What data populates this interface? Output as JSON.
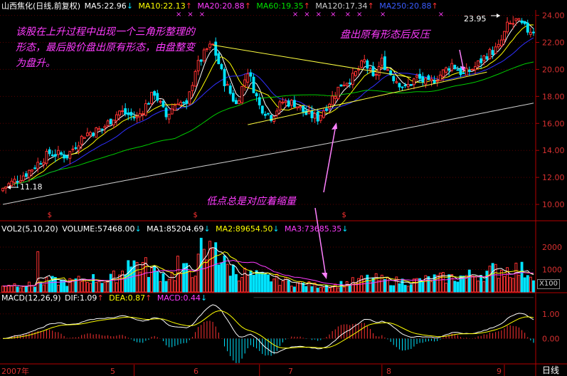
{
  "header": {
    "stock": "山西焦化(日线,前复权)",
    "ma5": "MA5:22.96",
    "ma10": "MA10:22.13",
    "ma20": "MA20:20.88",
    "ma60": "MA60:19.35",
    "ma120": "MA120:17.34",
    "ma250": "MA250:20.88"
  },
  "vol_header": {
    "label": "VOL2(5,10,20)",
    "volume": "VOLUME:57468.00",
    "ma1": "MA1:85204.69",
    "ma2": "MA2:89654.50",
    "ma3": "MA3:73685.35"
  },
  "macd_header": {
    "label": "MACD(12,26,9)",
    "dif": "DIF:1.09",
    "dea": "DEA:0.87",
    "macd": "MACD:0.44"
  },
  "annotations": {
    "triangle_note": "该股在上升过程中出现一个三角形整理的形态，最后股价盘出原有形态，由盘整变为盘升。",
    "breakout_note": "盘出原有形态后反压",
    "volume_note": "低点总是对应着缩量",
    "high_label": "23.95",
    "low_label": "11.18",
    "period_label": "日线",
    "vol_unit": "X100"
  },
  "colors": {
    "up": "#ff3232",
    "down": "#00e4ff",
    "ma5": "#ffffff",
    "ma10": "#ffff00",
    "ma20": "#3030ff",
    "ma60": "#00cc00",
    "ma120": "#cfcfcf",
    "annotation": "#ff3cff",
    "axis": "#b40000"
  },
  "chart_data": {
    "type": "candlestick",
    "x_ticks": [
      "2007年",
      "5",
      "6",
      "7",
      "8",
      "9"
    ],
    "price_axis": {
      "ticks": [
        "24.00",
        "22.00",
        "20.00",
        "18.00",
        "16.00",
        "14.00",
        "12.00",
        "10.00"
      ],
      "ylim": [
        9.0,
        24.4
      ]
    },
    "volume_axis": {
      "ticks": [
        "2000",
        "1000"
      ],
      "ylim": [
        0,
        2700
      ]
    },
    "macd_axis": {
      "ticks": [
        "1.00",
        "0.00"
      ],
      "ylim": [
        -1.0,
        1.6
      ]
    },
    "anchors": [
      [
        0,
        11.2
      ],
      [
        8,
        12.3
      ],
      [
        16,
        13.8
      ],
      [
        22,
        13.6
      ],
      [
        28,
        15.2
      ],
      [
        34,
        15.6
      ],
      [
        40,
        16.9
      ],
      [
        46,
        16.4
      ],
      [
        52,
        18.3
      ],
      [
        56,
        16.5
      ],
      [
        60,
        17.7
      ],
      [
        63,
        17.2
      ],
      [
        66,
        20.0
      ],
      [
        70,
        21.5
      ],
      [
        72,
        21.8
      ],
      [
        76,
        19.1
      ],
      [
        80,
        17.4
      ],
      [
        84,
        19.9
      ],
      [
        88,
        17.3
      ],
      [
        92,
        16.5
      ],
      [
        96,
        17.6
      ],
      [
        100,
        17.5
      ],
      [
        104,
        16.7
      ],
      [
        108,
        16.4
      ],
      [
        112,
        17.6
      ],
      [
        116,
        18.9
      ],
      [
        120,
        19.4
      ],
      [
        124,
        20.6
      ],
      [
        127,
        19.3
      ],
      [
        130,
        20.6
      ],
      [
        134,
        19.4
      ],
      [
        138,
        18.6
      ],
      [
        142,
        19.4
      ],
      [
        146,
        18.9
      ],
      [
        150,
        19.6
      ],
      [
        154,
        20.4
      ],
      [
        158,
        19.6
      ],
      [
        162,
        20.2
      ],
      [
        166,
        21.1
      ],
      [
        170,
        21.6
      ],
      [
        173,
        23.2
      ],
      [
        176,
        23.6
      ],
      [
        180,
        22.9
      ]
    ],
    "volume_anchors": [
      [
        0,
        350
      ],
      [
        12,
        300
      ],
      [
        16,
        500
      ],
      [
        22,
        420
      ],
      [
        30,
        600
      ],
      [
        36,
        500
      ],
      [
        46,
        1300
      ],
      [
        52,
        900
      ],
      [
        56,
        700
      ],
      [
        60,
        800
      ],
      [
        66,
        1100
      ],
      [
        70,
        1600
      ],
      [
        72,
        2000
      ],
      [
        76,
        1200
      ],
      [
        80,
        900
      ],
      [
        86,
        700
      ],
      [
        92,
        600
      ],
      [
        100,
        400
      ],
      [
        108,
        280
      ],
      [
        114,
        300
      ],
      [
        120,
        450
      ],
      [
        126,
        600
      ],
      [
        132,
        500
      ],
      [
        140,
        450
      ],
      [
        148,
        600
      ],
      [
        156,
        650
      ],
      [
        164,
        800
      ],
      [
        170,
        1000
      ],
      [
        176,
        1000
      ],
      [
        180,
        900
      ]
    ],
    "volume_spikes": [
      [
        12,
        1800
      ],
      [
        68,
        2400
      ],
      [
        73,
        2200
      ],
      [
        60,
        1600
      ],
      [
        43,
        1400
      ]
    ],
    "series": [
      {
        "name": "MA5",
        "period": 5
      },
      {
        "name": "MA10",
        "period": 10
      },
      {
        "name": "MA20",
        "period": 20
      },
      {
        "name": "MA60",
        "period": 60
      },
      {
        "name": "MA120",
        "period": 120
      }
    ],
    "high_marker": {
      "value": 23.95
    },
    "low_marker": {
      "value": 11.18
    },
    "trendlines": {
      "upper": [
        [
          72,
          21.8
        ],
        [
          140,
          19.4
        ]
      ],
      "lower": [
        [
          84,
          15.9
        ],
        [
          166,
          19.8
        ]
      ],
      "macd_upper": [
        [
          86,
          1.55
        ],
        [
          182,
          1.55
        ]
      ]
    }
  }
}
